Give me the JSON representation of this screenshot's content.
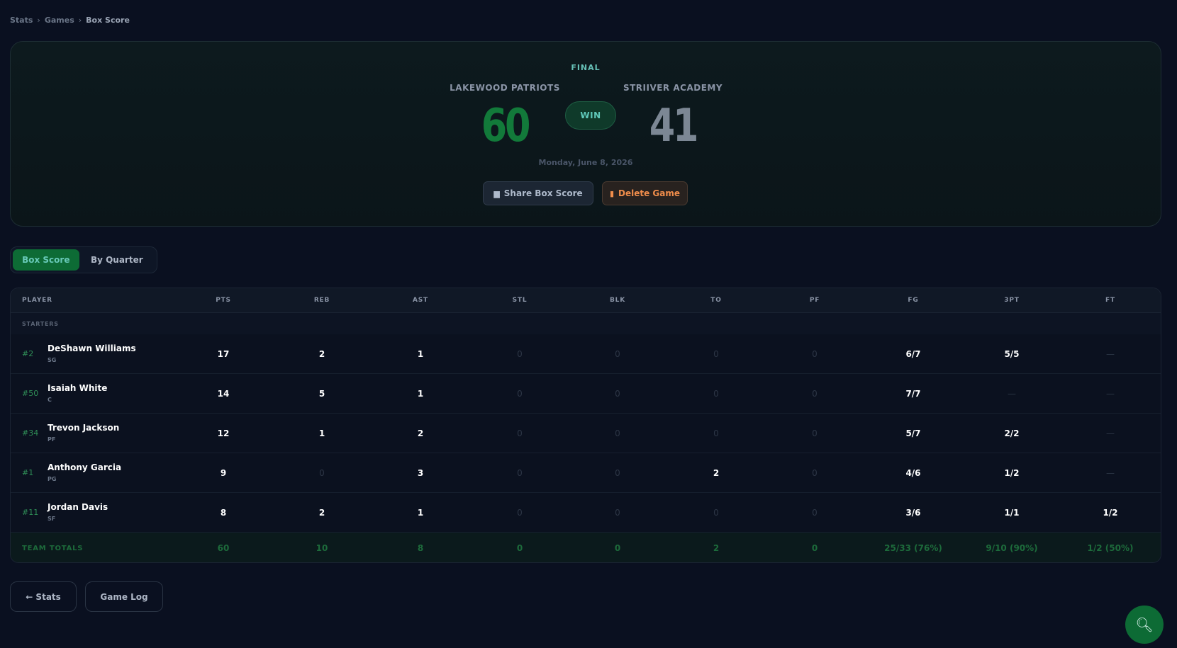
{
  "breadcrumb": {
    "items": [
      "Stats",
      "Games",
      "Box Score"
    ],
    "separator": "›"
  },
  "game": {
    "status": "FINAL",
    "home_team": "LAKEWOOD PATRIOTS",
    "away_team": "STRIIVER ACADEMY",
    "home_score": "60",
    "away_score": "41",
    "result": "WIN",
    "date": "Monday, June 8, 2026",
    "colors": {
      "home_score": "#127a3a",
      "away_score": "#7c8794",
      "accent": "#0d6b35"
    }
  },
  "actions": {
    "share_label": "Share Box Score",
    "share_icon": "document-icon",
    "delete_label": "Delete Game",
    "delete_icon": "trash-icon"
  },
  "tabs": [
    {
      "label": "Box Score",
      "active": true
    },
    {
      "label": "By Quarter",
      "active": false
    }
  ],
  "table": {
    "headers": [
      "PLAYER",
      "PTS",
      "REB",
      "AST",
      "STL",
      "BLK",
      "TO",
      "PF",
      "FG",
      "3PT",
      "FT"
    ],
    "section_label": "STARTERS",
    "rows": [
      {
        "number": "#2",
        "name": "DeShawn Williams",
        "pos": "SG",
        "stats": [
          "17",
          "2",
          "1",
          "0",
          "0",
          "0",
          "0",
          "6/7",
          "5/5",
          "—"
        ]
      },
      {
        "number": "#50",
        "name": "Isaiah White",
        "pos": "C",
        "stats": [
          "14",
          "5",
          "1",
          "0",
          "0",
          "0",
          "0",
          "7/7",
          "—",
          "—"
        ]
      },
      {
        "number": "#34",
        "name": "Trevon Jackson",
        "pos": "PF",
        "stats": [
          "12",
          "1",
          "2",
          "0",
          "0",
          "0",
          "0",
          "5/7",
          "2/2",
          "—"
        ]
      },
      {
        "number": "#1",
        "name": "Anthony Garcia",
        "pos": "PG",
        "stats": [
          "9",
          "0",
          "3",
          "0",
          "0",
          "2",
          "0",
          "4/6",
          "1/2",
          "—"
        ]
      },
      {
        "number": "#11",
        "name": "Jordan Davis",
        "pos": "SF",
        "stats": [
          "8",
          "2",
          "1",
          "0",
          "0",
          "0",
          "0",
          "3/6",
          "1/1",
          "1/2"
        ]
      }
    ],
    "totals_label": "TEAM TOTALS",
    "totals": [
      "60",
      "10",
      "8",
      "0",
      "0",
      "2",
      "0",
      "25/33 (76%)",
      "9/10 (90%)",
      "1/2 (50%)"
    ]
  },
  "footer": {
    "back_label": "← Stats",
    "gamelog_label": "Game Log",
    "fab_icon": "search-icon"
  }
}
